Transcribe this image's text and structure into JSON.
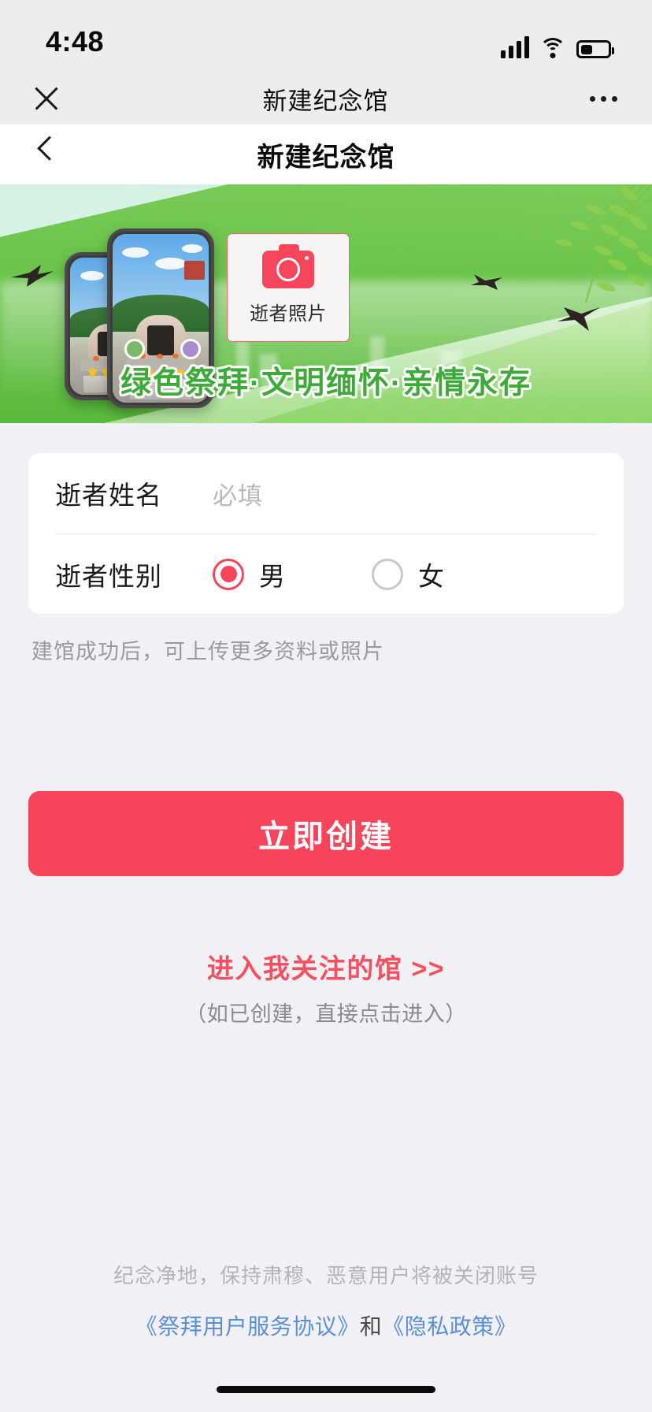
{
  "status_bar": {
    "time": "4:48",
    "signal_icon": "cellular-bars-icon",
    "wifi_icon": "wifi-icon",
    "battery_icon": "battery-icon"
  },
  "wechat_nav": {
    "close_icon": "close-icon",
    "title": "新建纪念馆",
    "more_icon": "more-dots-icon"
  },
  "page_header": {
    "back_icon": "chevron-left-icon",
    "title": "新建纪念馆"
  },
  "banner": {
    "upload": {
      "camera_icon": "camera-icon",
      "label": "逝者照片"
    },
    "tagline": "绿色祭拜·文明缅怀·亲情永存",
    "tagline_color": "#3faa3a",
    "phone_mockup_icon": "phone-memorial-preview",
    "swallow_icon": "swallow-bird-icon",
    "willow_icon": "willow-branch-icon"
  },
  "form": {
    "name_row": {
      "label": "逝者姓名",
      "value": "",
      "placeholder": "必填"
    },
    "gender_row": {
      "label": "逝者性别",
      "selected": "男",
      "options": [
        {
          "label": "男",
          "checked": true
        },
        {
          "label": "女",
          "checked": false
        }
      ]
    },
    "hint": "建馆成功后，可上传更多资料或照片"
  },
  "cta": {
    "label": "立即创建",
    "color": "#f6455b"
  },
  "entry": {
    "link": "进入我关注的馆 >>",
    "sub": "（如已创建，直接点击进入）",
    "color": "#f4505f"
  },
  "footer": {
    "notice": "纪念净地，保持肃穆、恶意用户将被关闭账号",
    "agreement_link": "《祭拜用户服务协议》",
    "conjunction": "和",
    "privacy_link": "《隐私政策》",
    "link_color": "#5a8fd6"
  }
}
